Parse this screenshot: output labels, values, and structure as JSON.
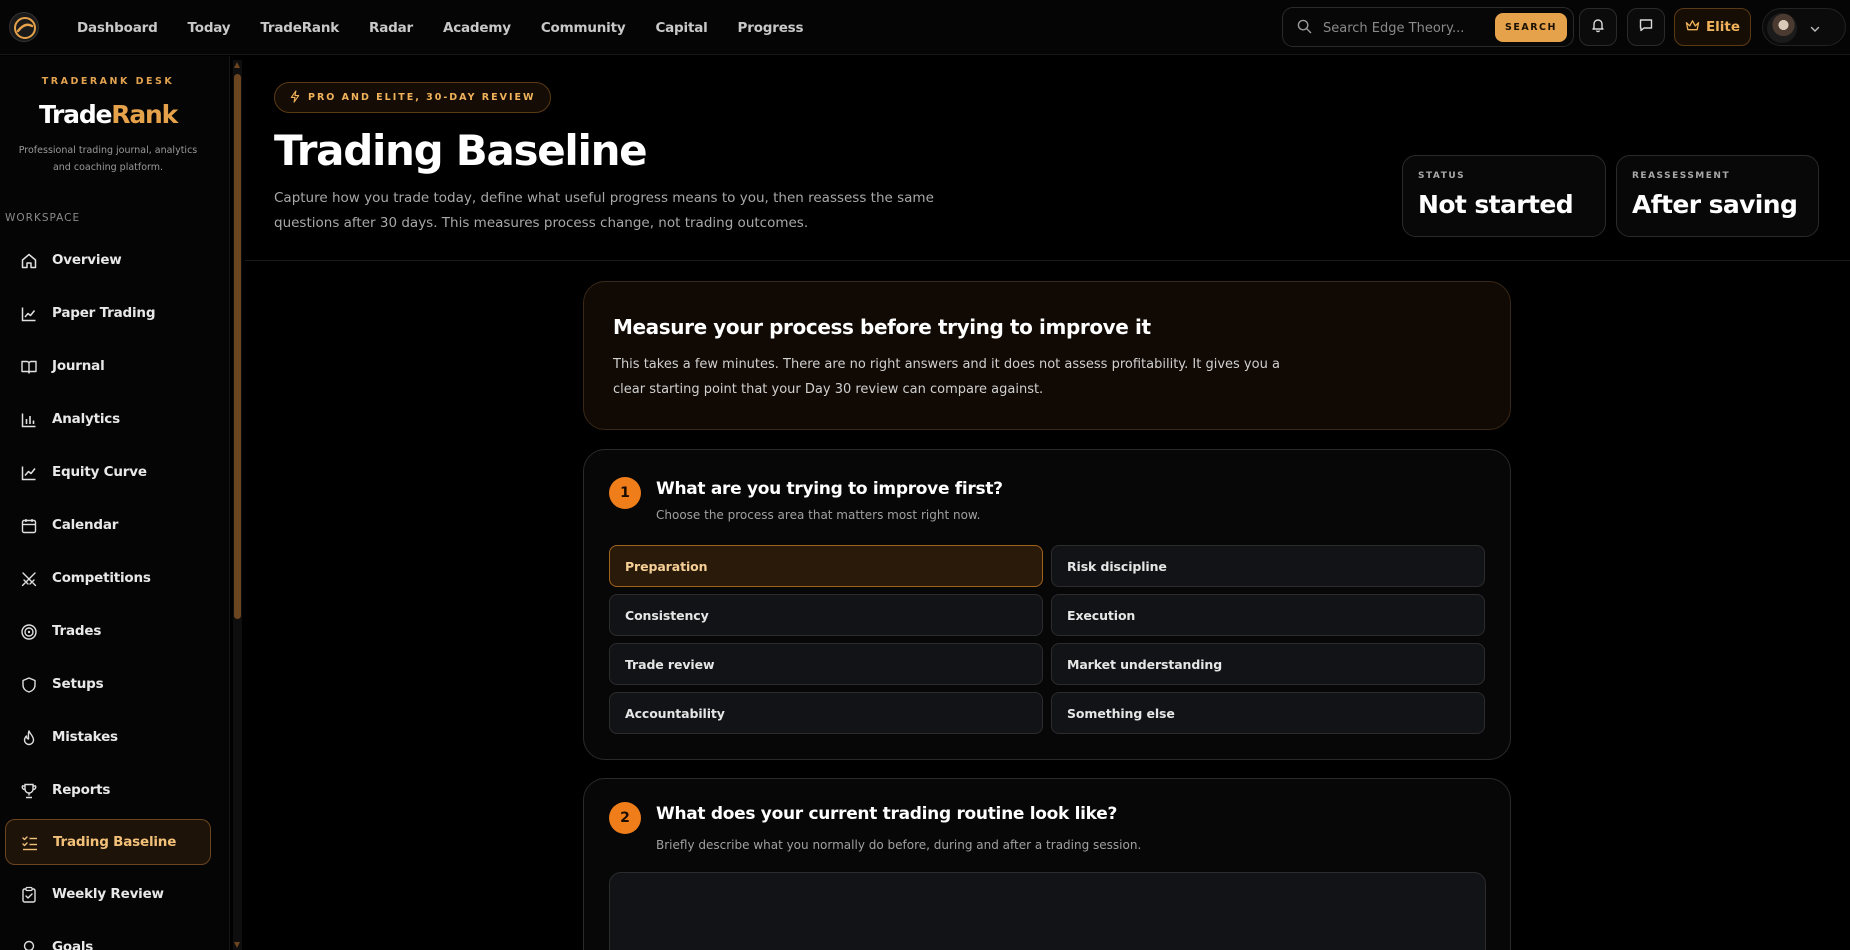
{
  "topbar": {
    "nav": [
      "Dashboard",
      "Today",
      "TradeRank",
      "Radar",
      "Academy",
      "Community",
      "Capital",
      "Progress"
    ],
    "search_placeholder": "Search Edge Theory...",
    "search_button": "SEARCH",
    "elite_label": "Elite"
  },
  "sidebar": {
    "desk_label": "TRADERANK DESK",
    "brand_part1": "Trade",
    "brand_part2": "Rank",
    "tagline": "Professional trading journal, analytics and coaching platform.",
    "section_label": "WORKSPACE",
    "items": [
      {
        "label": "Overview",
        "icon": "home-icon"
      },
      {
        "label": "Paper Trading",
        "icon": "line-chart-icon"
      },
      {
        "label": "Journal",
        "icon": "book-icon"
      },
      {
        "label": "Analytics",
        "icon": "bar-chart-icon"
      },
      {
        "label": "Equity Curve",
        "icon": "trend-icon"
      },
      {
        "label": "Calendar",
        "icon": "calendar-icon"
      },
      {
        "label": "Competitions",
        "icon": "swords-icon"
      },
      {
        "label": "Trades",
        "icon": "target-icon"
      },
      {
        "label": "Setups",
        "icon": "shield-icon"
      },
      {
        "label": "Mistakes",
        "icon": "flame-icon"
      },
      {
        "label": "Reports",
        "icon": "trophy-icon"
      },
      {
        "label": "Trading Baseline",
        "icon": "checklist-icon",
        "active": true
      },
      {
        "label": "Weekly Review",
        "icon": "clipboard-check-icon"
      },
      {
        "label": "Goals",
        "icon": "award-icon"
      }
    ]
  },
  "header": {
    "pill": "PRO AND ELITE, 30-DAY REVIEW",
    "title": "Trading Baseline",
    "description": "Capture how you trade today, define what useful progress means to you, then reassess the same questions after 30 days. This measures process change, not trading outcomes.",
    "status_label": "STATUS",
    "status_value": "Not started",
    "reassessment_label": "REASSESSMENT",
    "reassessment_value": "After saving"
  },
  "intro": {
    "title": "Measure your process before trying to improve it",
    "text": "This takes a few minutes. There are no right answers and it does not assess profitability. It gives you a clear starting point that your Day 30 review can compare against."
  },
  "question1": {
    "number": "1",
    "title": "What are you trying to improve first?",
    "subtitle": "Choose the process area that matters most right now.",
    "options": [
      "Preparation",
      "Risk discipline",
      "Consistency",
      "Execution",
      "Trade review",
      "Market understanding",
      "Accountability",
      "Something else"
    ],
    "selected": "Preparation"
  },
  "question2": {
    "number": "2",
    "title": "What does your current trading routine look like?",
    "subtitle": "Briefly describe what you normally do before, during and after a trading session."
  },
  "colors": {
    "accent": "#ee7d1a",
    "accent_light": "#e6a24a",
    "background": "#000000"
  }
}
